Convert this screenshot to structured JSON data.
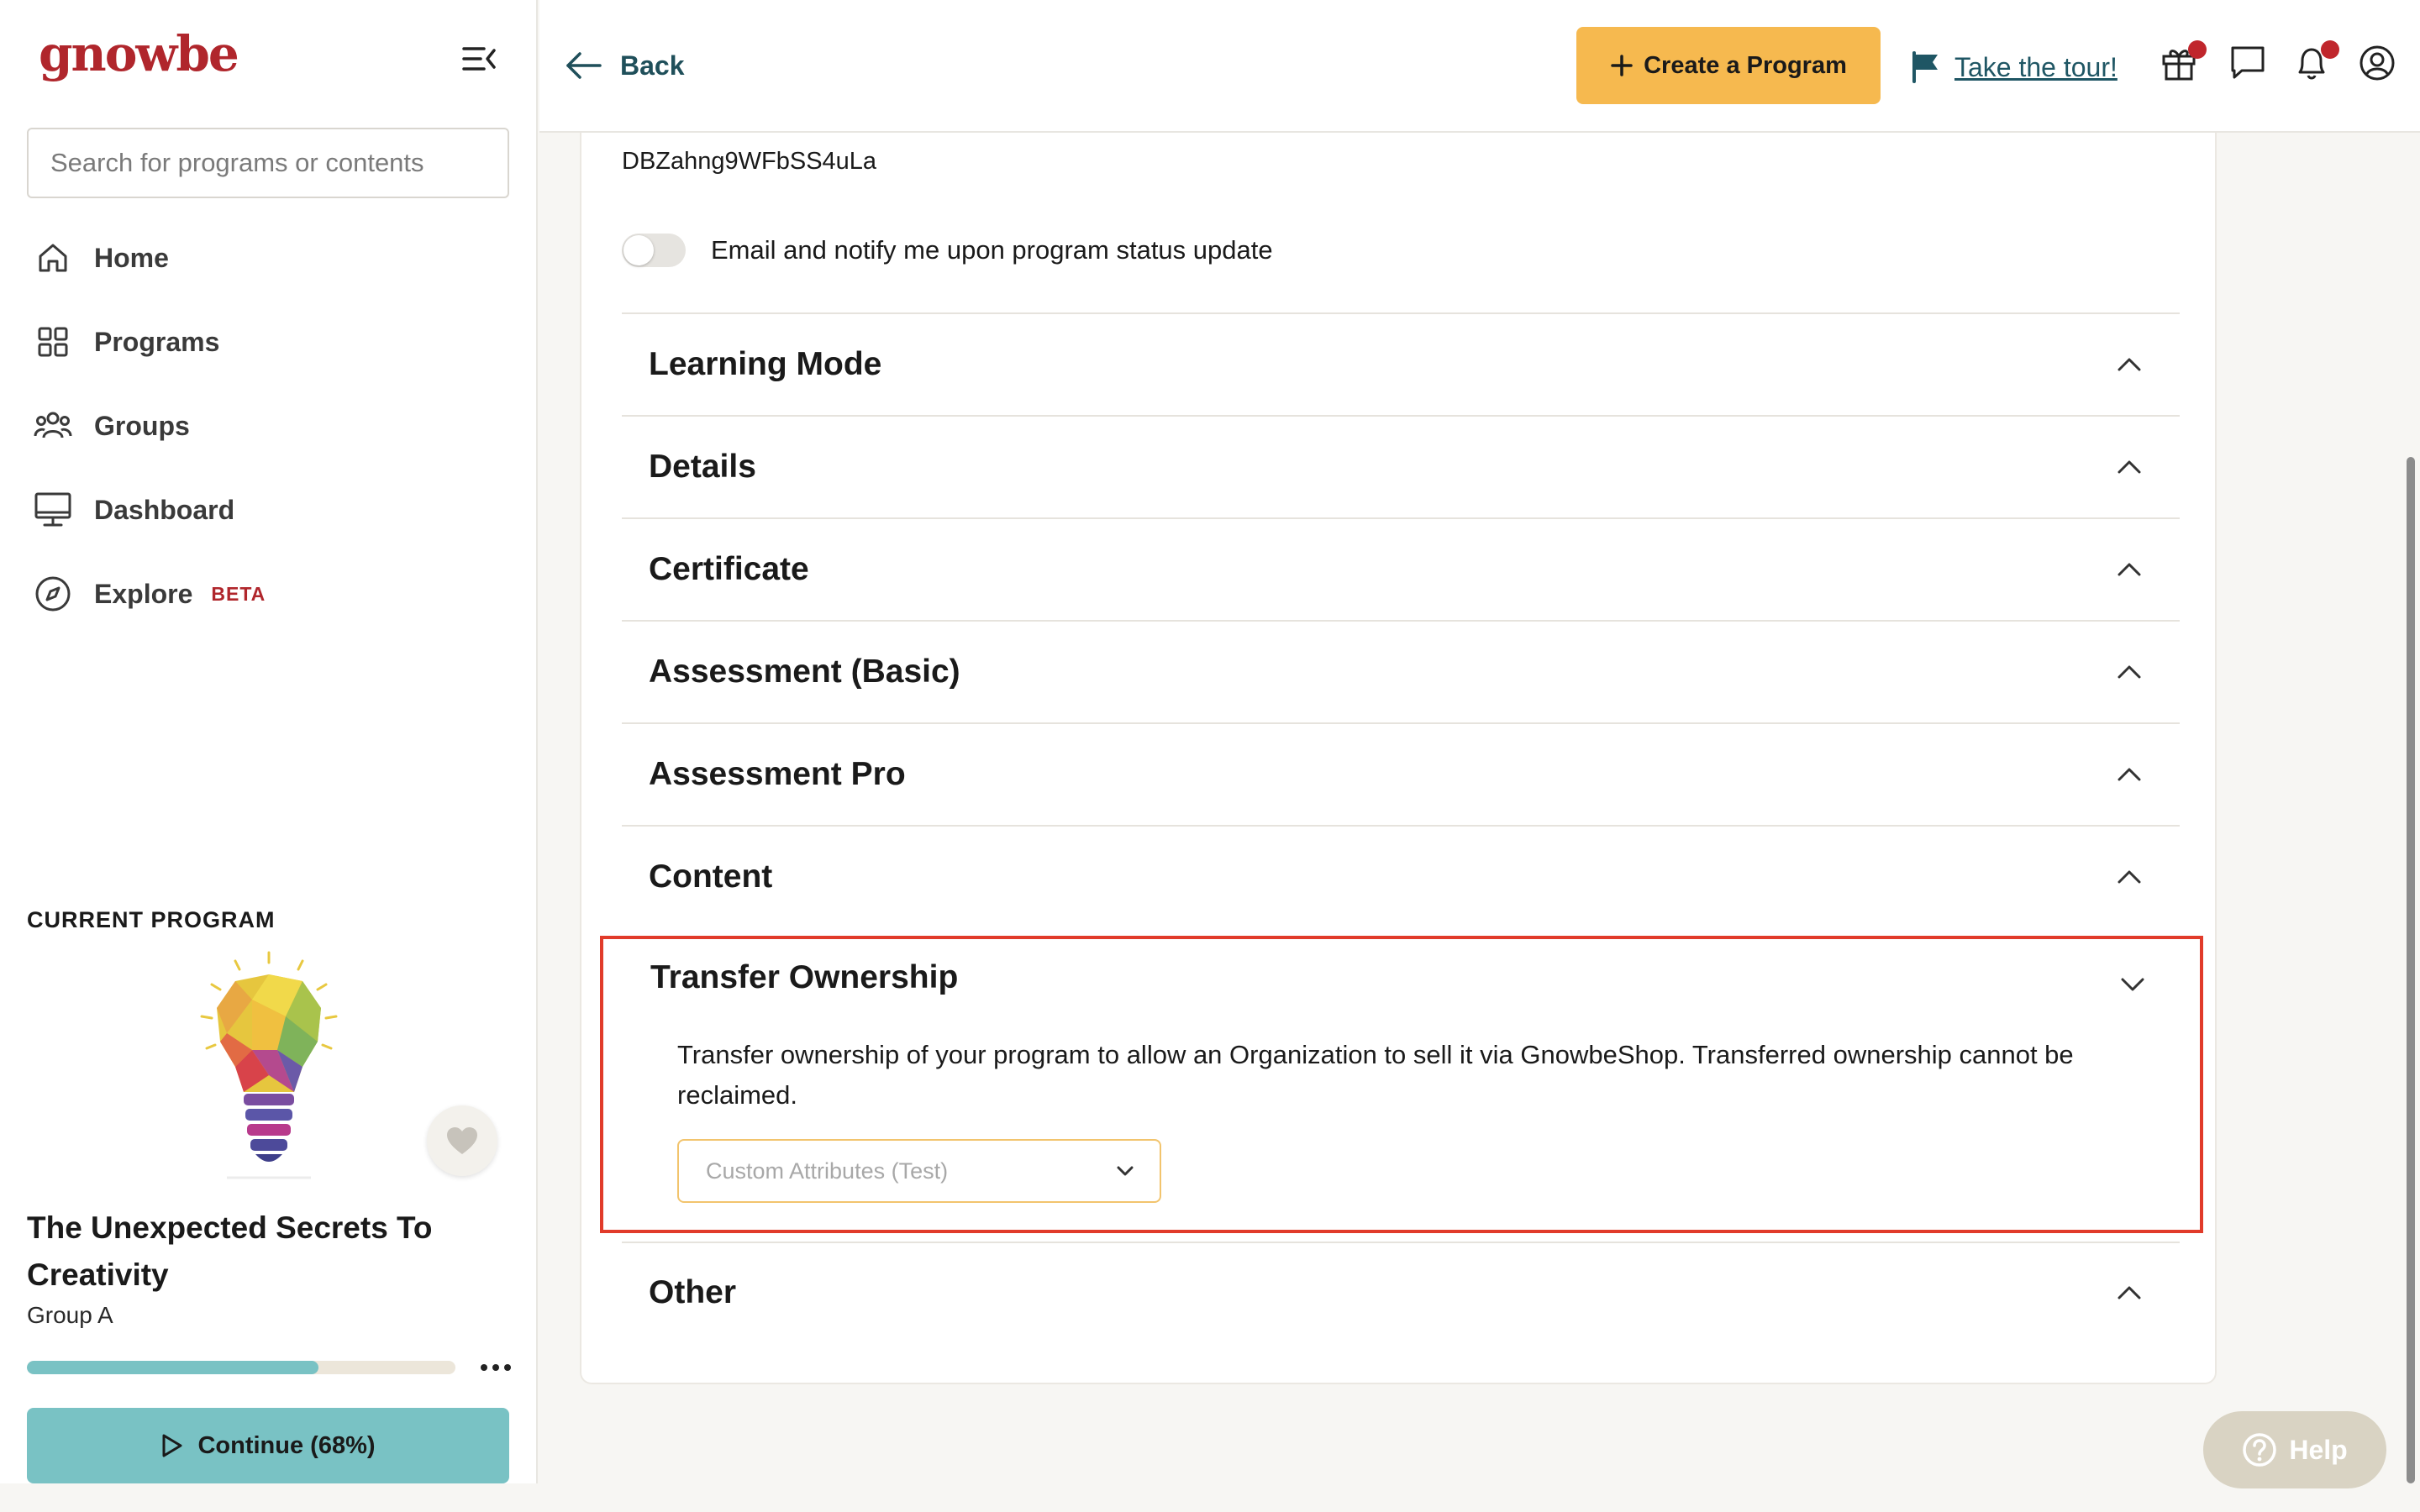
{
  "sidebar": {
    "logo": "gnowbe",
    "search_placeholder": "Search for programs or contents",
    "nav": [
      {
        "label": "Home",
        "icon": "home-icon"
      },
      {
        "label": "Programs",
        "icon": "grid-icon"
      },
      {
        "label": "Groups",
        "icon": "users-icon"
      },
      {
        "label": "Dashboard",
        "icon": "monitor-icon"
      },
      {
        "label": "Explore",
        "icon": "compass-icon",
        "badge": "BETA"
      }
    ],
    "current_program": {
      "heading": "CURRENT PROGRAM",
      "title": "The Unexpected Secrets To Creativity",
      "group": "Group A",
      "progress_fraction": 0.68,
      "continue_label": "Continue (68%)"
    }
  },
  "topbar": {
    "back_label": "Back",
    "create_label": "Create a Program",
    "tour_label": "Take the tour!",
    "icons": [
      "gift-icon",
      "chat-icon",
      "bell-icon",
      "profile-icon"
    ]
  },
  "main": {
    "program_id": "DBZahng9WFbSS4uLa",
    "notify_label": "Email and notify me upon program status update",
    "notify_on": false,
    "sections": [
      {
        "title": "Learning Mode",
        "expanded": false
      },
      {
        "title": "Details",
        "expanded": false
      },
      {
        "title": "Certificate",
        "expanded": false
      },
      {
        "title": "Assessment (Basic)",
        "expanded": false
      },
      {
        "title": "Assessment Pro",
        "expanded": false
      },
      {
        "title": "Content",
        "expanded": false
      }
    ],
    "transfer": {
      "title": "Transfer Ownership",
      "expanded": true,
      "description": "Transfer ownership of your program to allow an Organization to sell it via GnowbeShop. Transferred ownership cannot be reclaimed.",
      "select_placeholder": "Custom Attributes (Test)"
    },
    "other_section": {
      "title": "Other",
      "expanded": false
    }
  },
  "help_label": "Help",
  "colors": {
    "brand_red": "#b0262c",
    "accent_yellow": "#f6b94f",
    "accent_teal": "#79c2c4",
    "highlight_red": "#e13b2a"
  }
}
